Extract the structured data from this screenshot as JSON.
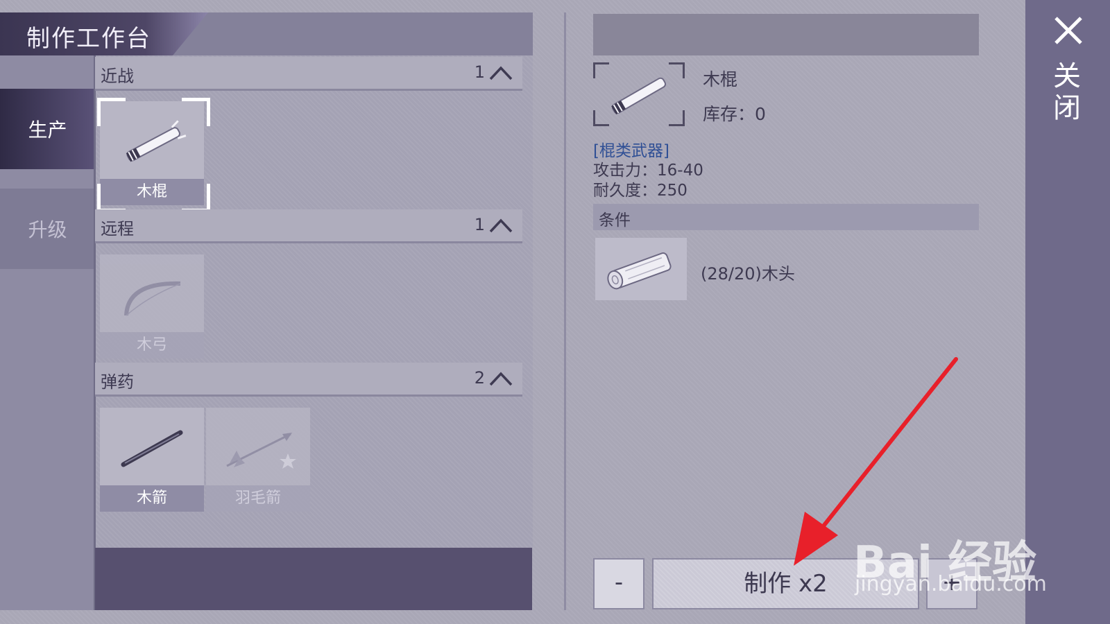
{
  "window": {
    "title": "制作工作台"
  },
  "sidebar": {
    "items": [
      {
        "label": "生产",
        "active": true
      },
      {
        "label": "升级",
        "active": false
      }
    ]
  },
  "categories": [
    {
      "label": "近战",
      "count": "1",
      "items": [
        {
          "label": "木棍",
          "icon": "wooden-stick-icon",
          "selected": true
        }
      ]
    },
    {
      "label": "远程",
      "count": "1",
      "items": [
        {
          "label": "木弓",
          "icon": "wooden-bow-icon",
          "selected": false
        }
      ]
    },
    {
      "label": "弹药",
      "count": "2",
      "items": [
        {
          "label": "木箭",
          "icon": "wooden-arrow-icon",
          "selected": false
        },
        {
          "label": "羽毛箭",
          "icon": "feather-arrow-icon",
          "selected": false
        }
      ]
    }
  ],
  "detail": {
    "name": "木棍",
    "stock": "库存：0",
    "type": "[棍类武器]",
    "attack": "攻击力：16-40",
    "durability": "耐久度：250",
    "conditions_label": "条件",
    "material": {
      "text": "(28/20)木头",
      "icon": "wood-log-icon"
    }
  },
  "actions": {
    "minus": "-",
    "craft": "制作 x2",
    "plus": "+"
  },
  "close": {
    "label": "关闭"
  },
  "watermark": {
    "logo": "Bai 经验",
    "url": "jingyan.baidu.com"
  },
  "colors": {
    "accent_dark": "#4e4666",
    "link_blue": "#2f4f95",
    "arrow_red": "#e8202a"
  }
}
